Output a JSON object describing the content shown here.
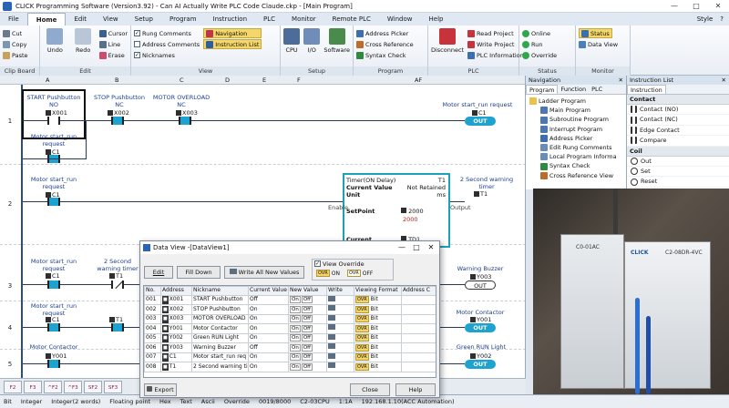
{
  "window": {
    "title": "CLICK Programming Software (Version3.92) - Can AI Actually Write PLC Code Claude.ckp - [Main Program]",
    "minimize": "—",
    "maximize": "□",
    "close": "✕"
  },
  "menu": {
    "tabs": [
      "File",
      "Home",
      "Edit",
      "View",
      "Setup",
      "Program",
      "Instruction",
      "PLC",
      "Monitor",
      "Remote PLC",
      "Window",
      "Help"
    ],
    "active": "Home",
    "style": "Style",
    "help_icon": "?"
  },
  "ribbon": {
    "clipboard": {
      "cut": "Cut",
      "copy": "Copy",
      "paste": "Paste",
      "label": "Clip Board"
    },
    "edit": {
      "undo": "Undo",
      "redo": "Redo",
      "cursor": "Cursor",
      "line": "Line",
      "erase": "Erase",
      "label": "Edit"
    },
    "view": {
      "rung_comments": "Rung Comments",
      "address_comments": "Address Comments",
      "nicknames": "Nicknames",
      "navigation": "Navigation",
      "instruction_list": "Instruction List",
      "label": "View"
    },
    "setup": {
      "cpu": "CPU",
      "io": "I/O",
      "software": "Software",
      "label": "Setup"
    },
    "program": {
      "address_picker": "Address Picker",
      "cross_reference": "Cross Reference",
      "syntax_check": "Syntax Check",
      "label": "Program"
    },
    "plc": {
      "disconnect": "Disconnect",
      "read_project": "Read Project",
      "write_project": "Write Project",
      "plc_information": "PLC Information",
      "label": "PLC"
    },
    "status": {
      "online": "Online",
      "run": "Run",
      "override": "Override",
      "label": "Status"
    },
    "monitor": {
      "status": "Status",
      "data_view": "Data View",
      "label": "Monitor"
    }
  },
  "ladder": {
    "columns": [
      "A",
      "B",
      "C",
      "D",
      "E",
      "F",
      "AF"
    ],
    "rows": [
      "1",
      "2",
      "3",
      "4",
      "5"
    ],
    "rung1": {
      "c1_name": "START Pushbutton",
      "c1_type": "NO",
      "c1_addr": "X001",
      "c2_name": "STOP Pushbutton",
      "c2_type": "NC",
      "c2_addr": "X002",
      "c3_name": "MOTOR OVERLOAD",
      "c3_type": "NC",
      "c3_addr": "X003",
      "coil_name": "Motor start_run request",
      "coil_addr": "C1",
      "coil_label": "OUT",
      "seal_name": "Motor start_run request",
      "seal_addr": "C1"
    },
    "rung2": {
      "c1_name": "Motor start_run request",
      "c1_addr": "C1",
      "timer_title": "Timer(ON Delay)",
      "timer_addr": "T1",
      "current_value_label": "Current Value",
      "current_value": "Not Retained",
      "unit_label": "Unit",
      "unit": "ms",
      "setpoint_label": "SetPoint",
      "setpoint_addr": "2000",
      "setpoint_value": "2000",
      "current_label": "Current",
      "current_addr": "TD1",
      "enable": "Enable",
      "output": "Output",
      "coil_name": "2 Second warning timer",
      "coil_addr": "T1"
    },
    "rung3": {
      "c1_name": "Motor start_run request",
      "c1_addr": "C1",
      "c2_name": "2 Second warning timer",
      "c2_addr": "T1",
      "coil_name": "Warning Buzzer",
      "coil_addr": "Y003",
      "coil_label": "OUT"
    },
    "rung4": {
      "c1_name": "Motor start_run request",
      "c1_addr": "C1",
      "c2_addr": "T1",
      "coil_name": "Motor Contactor",
      "coil_addr": "Y001",
      "coil_label": "OUT"
    },
    "rung5": {
      "c1_name": "Motor Contactor",
      "c1_addr": "Y001",
      "coil_name": "Green RUN Light",
      "coil_addr": "Y002",
      "coil_label": "OUT"
    }
  },
  "function_keys": [
    "F2",
    "F3",
    "^F2",
    "^F3",
    "SF2",
    "SF3"
  ],
  "status_bar": [
    "Bit",
    "Integer",
    "Integer(2 words)",
    "Floating point",
    "Hex",
    "Text",
    "Ascii",
    "Override",
    "0019/8000",
    "C2-03CPU",
    "1:1A",
    "192.168.1.10(ACC Automation)"
  ],
  "navigation": {
    "title": "Navigation",
    "tabs": [
      "Program",
      "Function",
      "PLC"
    ],
    "items": [
      "Ladder Program",
      "Main Program",
      "Subroutine Program",
      "Interrupt Program",
      "Address Picker",
      "Edit Rung Comments",
      "Local Program Informa",
      "Syntax Check",
      "Cross Reference View"
    ]
  },
  "instruction_list": {
    "title": "Instruction List",
    "tab": "Instruction",
    "contact_header": "Contact",
    "contacts": [
      "Contact (NO)",
      "Contact (NC)",
      "Edge Contact",
      "Compare"
    ],
    "coil_header": "Coil",
    "coils": [
      "Out",
      "Set",
      "Reset"
    ]
  },
  "photo": {
    "unit1": "C0-01AC",
    "unit2": "C2-08DR-4VC",
    "brand": "CLICK"
  },
  "data_view": {
    "title": "Data View -[DataView1]",
    "edit": "Edit",
    "fill_down": "Fill Down",
    "write_all": "Write All New Values",
    "view_override": "View Override",
    "ovr": "OVR",
    "on": "ON",
    "off": "OFF",
    "columns": [
      "No.",
      "Address",
      "Nickname",
      "Current Value",
      "New Value",
      "Write",
      "Viewing Format",
      "Address C"
    ],
    "rows": [
      {
        "no": "001",
        "addr": "X001",
        "nick": "START Pushbutton",
        "cur": "Off",
        "fmt": "Bit"
      },
      {
        "no": "002",
        "addr": "X002",
        "nick": "STOP Pushbutton",
        "cur": "On",
        "fmt": "Bit"
      },
      {
        "no": "003",
        "addr": "X003",
        "nick": "MOTOR OVERLOAD",
        "cur": "On",
        "fmt": "Bit"
      },
      {
        "no": "004",
        "addr": "Y001",
        "nick": "Motor Contactor",
        "cur": "On",
        "fmt": "Bit"
      },
      {
        "no": "005",
        "addr": "Y002",
        "nick": "Green RUN Light",
        "cur": "On",
        "fmt": "Bit"
      },
      {
        "no": "006",
        "addr": "Y003",
        "nick": "Warning Buzzer",
        "cur": "Off",
        "fmt": "Bit"
      },
      {
        "no": "007",
        "addr": "C1",
        "nick": "Motor start_run req",
        "cur": "On",
        "fmt": "Bit"
      },
      {
        "no": "008",
        "addr": "T1",
        "nick": "2 Second warning ti",
        "cur": "On",
        "fmt": "Bit"
      }
    ],
    "new_on": "On",
    "new_off": "Off",
    "export": "Export",
    "close": "Close",
    "help": "Help"
  }
}
